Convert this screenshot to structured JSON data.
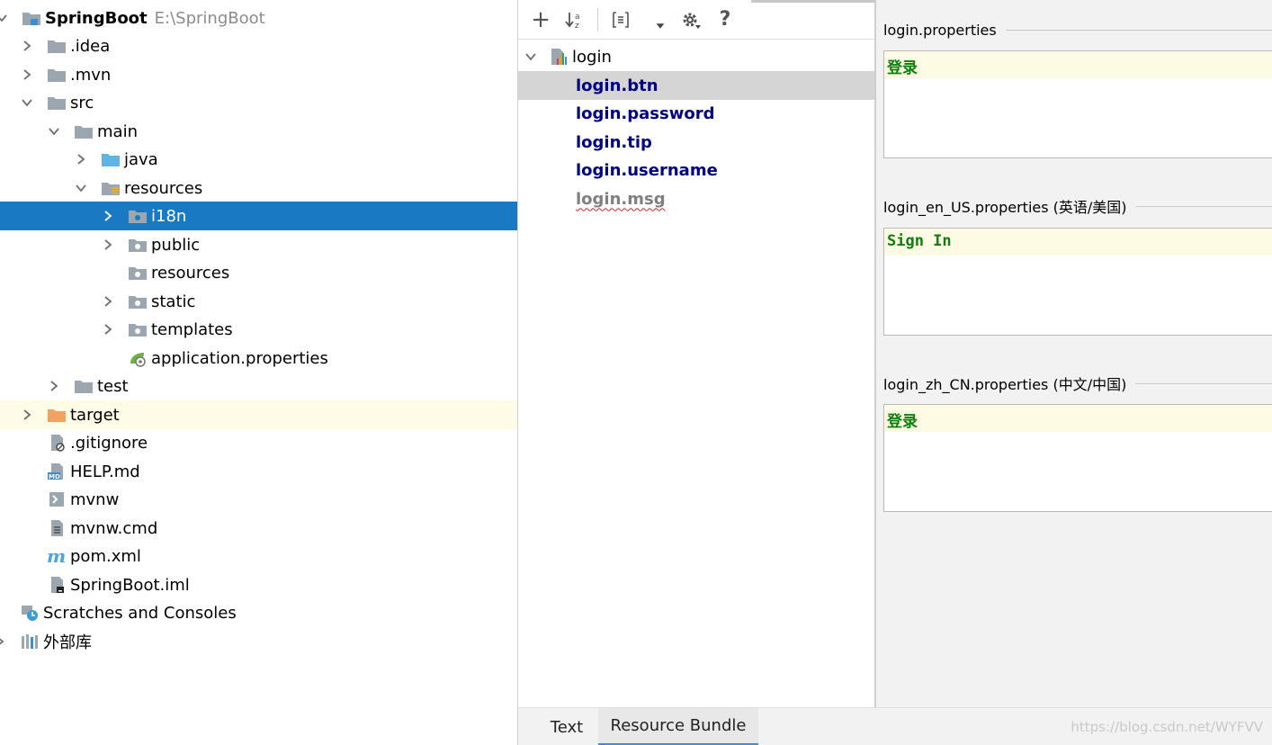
{
  "project_tree": {
    "root": {
      "label": "SpringBoot",
      "path": "E:\\SpringBoot"
    },
    "items": [
      {
        "label": ".idea"
      },
      {
        "label": ".mvn"
      },
      {
        "label": "src"
      },
      {
        "label": "main"
      },
      {
        "label": "java"
      },
      {
        "label": "resources"
      },
      {
        "label": "i18n"
      },
      {
        "label": "public"
      },
      {
        "label": "resources"
      },
      {
        "label": "static"
      },
      {
        "label": "templates"
      },
      {
        "label": "application.properties"
      },
      {
        "label": "test"
      },
      {
        "label": "target"
      },
      {
        "label": ".gitignore"
      },
      {
        "label": "HELP.md"
      },
      {
        "label": "mvnw"
      },
      {
        "label": "mvnw.cmd"
      },
      {
        "label": "pom.xml"
      },
      {
        "label": "SpringBoot.iml"
      },
      {
        "label": "Scratches and Consoles"
      },
      {
        "label": "外部库"
      }
    ]
  },
  "resource_bundle": {
    "toolbar": {
      "add": "+",
      "help": "?"
    },
    "bundle_name": "login",
    "keys": [
      "login.btn",
      "login.password",
      "login.tip",
      "login.username",
      "login.msg"
    ]
  },
  "properties": [
    {
      "file": "login.properties",
      "value": "登录"
    },
    {
      "file": "login_en_US.properties (英语/美国)",
      "value": "Sign In"
    },
    {
      "file": "login_zh_CN.properties (中文/中国)",
      "value": "登录"
    }
  ],
  "bottom_tabs": [
    "Text",
    "Resource Bundle"
  ],
  "watermark": "https://blog.csdn.net/WYFVV",
  "colors": {
    "selection": "#1a79c3",
    "key_text": "#000080",
    "value_text": "#0d7f0d",
    "value_bg": "#fefbe4"
  }
}
